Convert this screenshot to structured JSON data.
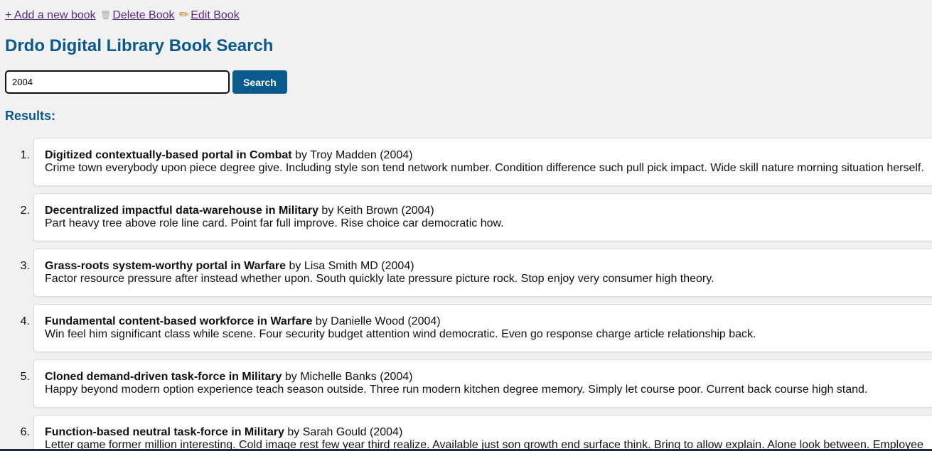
{
  "toplinks": {
    "add_label": "+ Add a new book",
    "delete_label": "Delete Book",
    "edit_label": "Edit Book"
  },
  "page_title": "Drdo Digital Library Book Search",
  "search": {
    "value": "2004",
    "button_label": "Search"
  },
  "results_heading": "Results:",
  "results": [
    {
      "num": "1.",
      "title": "Digitized contextually-based portal in Combat",
      "byline": " by Troy Madden (2004)",
      "desc": "Crime town everybody upon piece degree give. Including style son tend network number. Condition difference such pull pick impact. Wide skill nature morning situation herself."
    },
    {
      "num": "2.",
      "title": "Decentralized impactful data-warehouse in Military",
      "byline": " by Keith Brown (2004)",
      "desc": "Part heavy tree above role line card. Point far full improve. Rise choice car democratic how."
    },
    {
      "num": "3.",
      "title": "Grass-roots system-worthy portal in Warfare",
      "byline": " by Lisa Smith MD (2004)",
      "desc": "Factor resource pressure after instead whether upon. South quickly late pressure picture rock. Stop enjoy very consumer high theory."
    },
    {
      "num": "4.",
      "title": "Fundamental content-based workforce in Warfare",
      "byline": " by Danielle Wood (2004)",
      "desc": "Win feel him significant class while scene. Four security budget attention wind democratic. Even go response charge article relationship back."
    },
    {
      "num": "5.",
      "title": "Cloned demand-driven task-force in Military",
      "byline": " by Michelle Banks (2004)",
      "desc": "Happy beyond modern option experience teach season outside. Three run modern kitchen degree memory. Simply let course poor. Current back course high stand."
    },
    {
      "num": "6.",
      "title": "Function-based neutral task-force in Military",
      "byline": " by Sarah Gould (2004)",
      "desc": "Letter game former million interesting. Cold image rest few year third realize. Available just son growth end surface think. Bring to allow explain. Alone look between. Employee"
    }
  ],
  "colors": {
    "accent": "#0b5a8e",
    "link": "#5b2a86",
    "background": "#f1f1f1"
  },
  "icons": [
    "trash-icon",
    "pencil-icon"
  ]
}
